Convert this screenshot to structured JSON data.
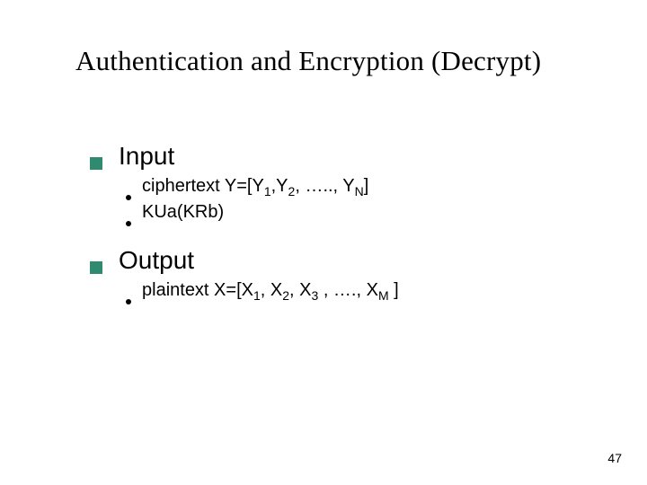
{
  "slide": {
    "title": "Authentication and Encryption (Decrypt)",
    "page_number": "47",
    "sections": [
      {
        "heading": "Input",
        "items": [
          {
            "prefix": "ciphertext Y=[Y",
            "s1": "1",
            "mid1": ",Y",
            "s2": "2",
            "mid2": ", ….., Y",
            "s3": "N",
            "suffix": "]"
          },
          {
            "plain": "KUa(KRb)"
          }
        ]
      },
      {
        "heading": "Output",
        "items": [
          {
            "prefix": "plaintext X=[X",
            "s1": "1",
            "mid1": ", X",
            "s2": "2",
            "mid2": ",  X",
            "s3": "3",
            "mid3": " , …., X",
            "s4": "M",
            "suffix": " ]"
          }
        ]
      }
    ]
  }
}
